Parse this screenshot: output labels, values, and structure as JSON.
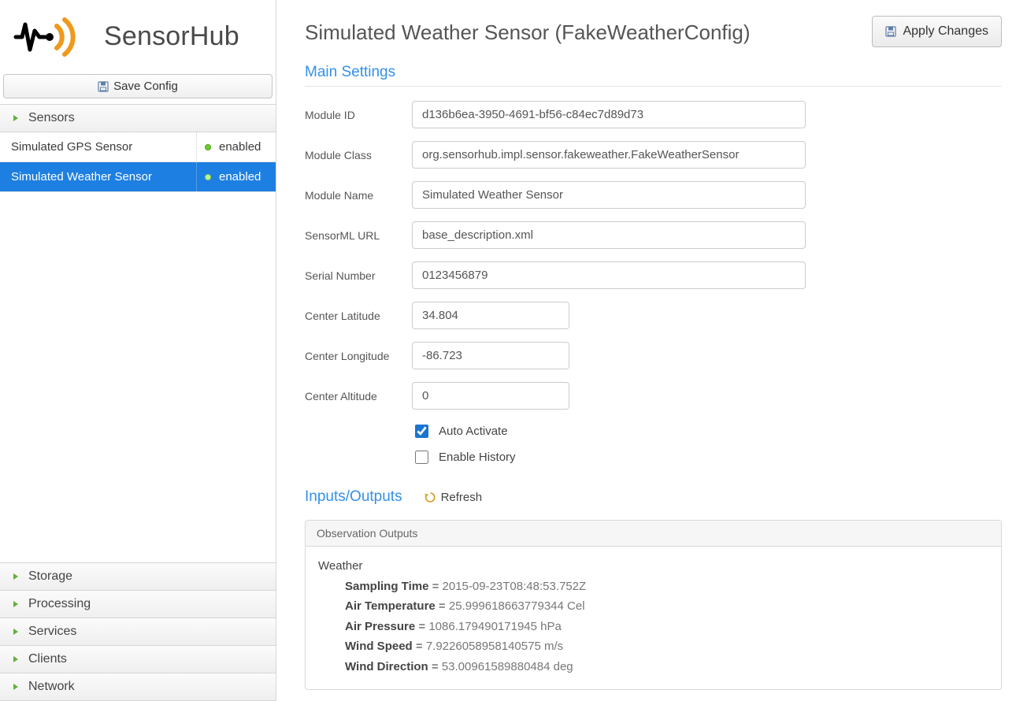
{
  "app": {
    "name": "SensorHub"
  },
  "toolbar": {
    "save_config": "Save Config",
    "apply_changes": "Apply Changes"
  },
  "sidebar": {
    "sections": {
      "sensors": "Sensors",
      "storage": "Storage",
      "processing": "Processing",
      "services": "Services",
      "clients": "Clients",
      "network": "Network"
    },
    "sensors": [
      {
        "name": "Simulated GPS Sensor",
        "status": "enabled",
        "selected": false
      },
      {
        "name": "Simulated Weather Sensor",
        "status": "enabled",
        "selected": true
      }
    ]
  },
  "page": {
    "title": "Simulated Weather Sensor (FakeWeatherConfig)",
    "section_main": "Main Settings",
    "section_io": "Inputs/Outputs",
    "refresh": "Refresh"
  },
  "form": {
    "labels": {
      "module_id": "Module ID",
      "module_class": "Module Class",
      "module_name": "Module Name",
      "sensorml_url": "SensorML URL",
      "serial_number": "Serial Number",
      "center_lat": "Center Latitude",
      "center_lon": "Center Longitude",
      "center_alt": "Center Altitude",
      "auto_activate": "Auto Activate",
      "enable_history": "Enable History"
    },
    "values": {
      "module_id": "d136b6ea-3950-4691-bf56-c84ec7d89d73",
      "module_class": "org.sensorhub.impl.sensor.fakeweather.FakeWeatherSensor",
      "module_name": "Simulated Weather Sensor",
      "sensorml_url": "base_description.xml",
      "serial_number": "0123456879",
      "center_lat": "34.804",
      "center_lon": "-86.723",
      "center_alt": "0",
      "auto_activate": true,
      "enable_history": false
    }
  },
  "outputs": {
    "panel_title": "Observation Outputs",
    "group": "Weather",
    "items": [
      {
        "label": "Sampling Time",
        "value": "2015-09-23T08:48:53.752Z"
      },
      {
        "label": "Air Temperature",
        "value": "25.999618663779344 Cel"
      },
      {
        "label": "Air Pressure",
        "value": "1086.179490171945 hPa"
      },
      {
        "label": "Wind Speed",
        "value": "7.9226058958140575 m/s"
      },
      {
        "label": "Wind Direction",
        "value": "53.00961589880484 deg"
      }
    ]
  }
}
